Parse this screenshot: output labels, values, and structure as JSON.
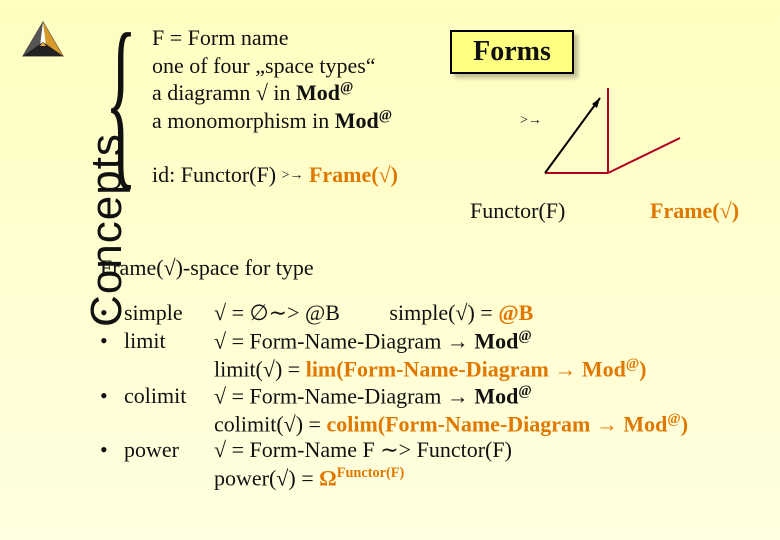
{
  "side_label": "Concepts",
  "top": {
    "l1": "F = Form name",
    "l2": "one of four „space types“",
    "l3a": "a diagramn √ in ",
    "l3b": "Mod",
    "l3c": "@",
    "l4a": "a monomorphism in ",
    "l4b": "Mod",
    "l4c": "@"
  },
  "id": {
    "a": "id: Functor(F) ",
    "arrow": ">→",
    "b": "  Frame(√)"
  },
  "forms_title": "Forms",
  "diag_arrow": ">→",
  "func_label": "Functor(F)",
  "frame_label": "Frame(√)",
  "frame_type": "Frame(√)-space for type",
  "bullets": {
    "simple": {
      "kind": "simple",
      "def_a": "√ = ∅∼> @B",
      "def_b": "simple(√) = ",
      "def_c": "@B"
    },
    "limit": {
      "kind": "limit",
      "def_a": "√ = Form-Name-Diagram → ",
      "def_b": "Mod",
      "def_c": "@",
      "line2_a": "limit(√) = ",
      "line2_b": "lim(Form-Name-Diagram → Mod",
      "line2_c": "@",
      "line2_d": ")"
    },
    "colimit": {
      "kind": "colimit",
      "def_a": "√ = Form-Name-Diagram → ",
      "def_b": "Mod",
      "def_c": "@",
      "line2_a": "colimit(√) = ",
      "line2_b": "colim(Form-Name-Diagram → Mod",
      "line2_c": "@",
      "line2_d": ")"
    },
    "power": {
      "kind": "power",
      "def_a": "√ = Form-Name F ∼> Functor(F)",
      "line2_a": "power(√) = ",
      "line2_b": "Ω",
      "line2_c": "Functor(F)"
    }
  }
}
